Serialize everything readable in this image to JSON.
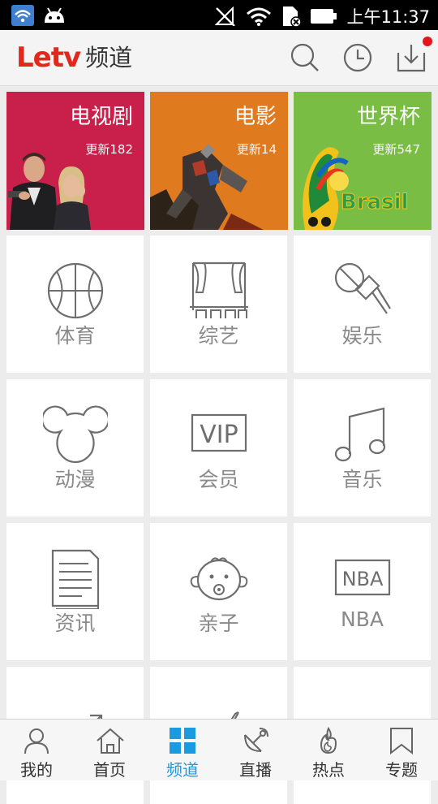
{
  "status_bar": {
    "time": "上午11:37"
  },
  "header": {
    "brand": "Letv",
    "title": "频道"
  },
  "featured": [
    {
      "title": "电视剧",
      "update": "更新182",
      "color": "#c8204a"
    },
    {
      "title": "电影",
      "update": "更新14",
      "color": "#e07a1e"
    },
    {
      "title": "世界杯",
      "update": "更新547",
      "color": "#79bd44",
      "art_text": "Brasil"
    }
  ],
  "channels": [
    {
      "label": "体育",
      "icon": "basketball-icon"
    },
    {
      "label": "综艺",
      "icon": "stage-icon"
    },
    {
      "label": "娱乐",
      "icon": "microphone-icon"
    },
    {
      "label": "动漫",
      "icon": "mouse-ears-icon"
    },
    {
      "label": "会员",
      "icon": "vip-icon",
      "icon_text": "VIP"
    },
    {
      "label": "音乐",
      "icon": "music-note-icon"
    },
    {
      "label": "资讯",
      "icon": "news-document-icon"
    },
    {
      "label": "亲子",
      "icon": "baby-face-icon"
    },
    {
      "label": "NBA",
      "icon": "nba-icon",
      "icon_text": "NBA"
    }
  ],
  "bottom_nav": [
    {
      "label": "我的",
      "icon": "person-icon"
    },
    {
      "label": "首页",
      "icon": "home-icon"
    },
    {
      "label": "频道",
      "icon": "grid-icon",
      "active": true
    },
    {
      "label": "直播",
      "icon": "satellite-icon"
    },
    {
      "label": "热点",
      "icon": "flame-icon"
    },
    {
      "label": "专题",
      "icon": "bookmark-icon"
    }
  ],
  "colors": {
    "brand_red": "#e2271d",
    "active_blue": "#1a9be0",
    "icon_gray": "#6e6e6e"
  }
}
